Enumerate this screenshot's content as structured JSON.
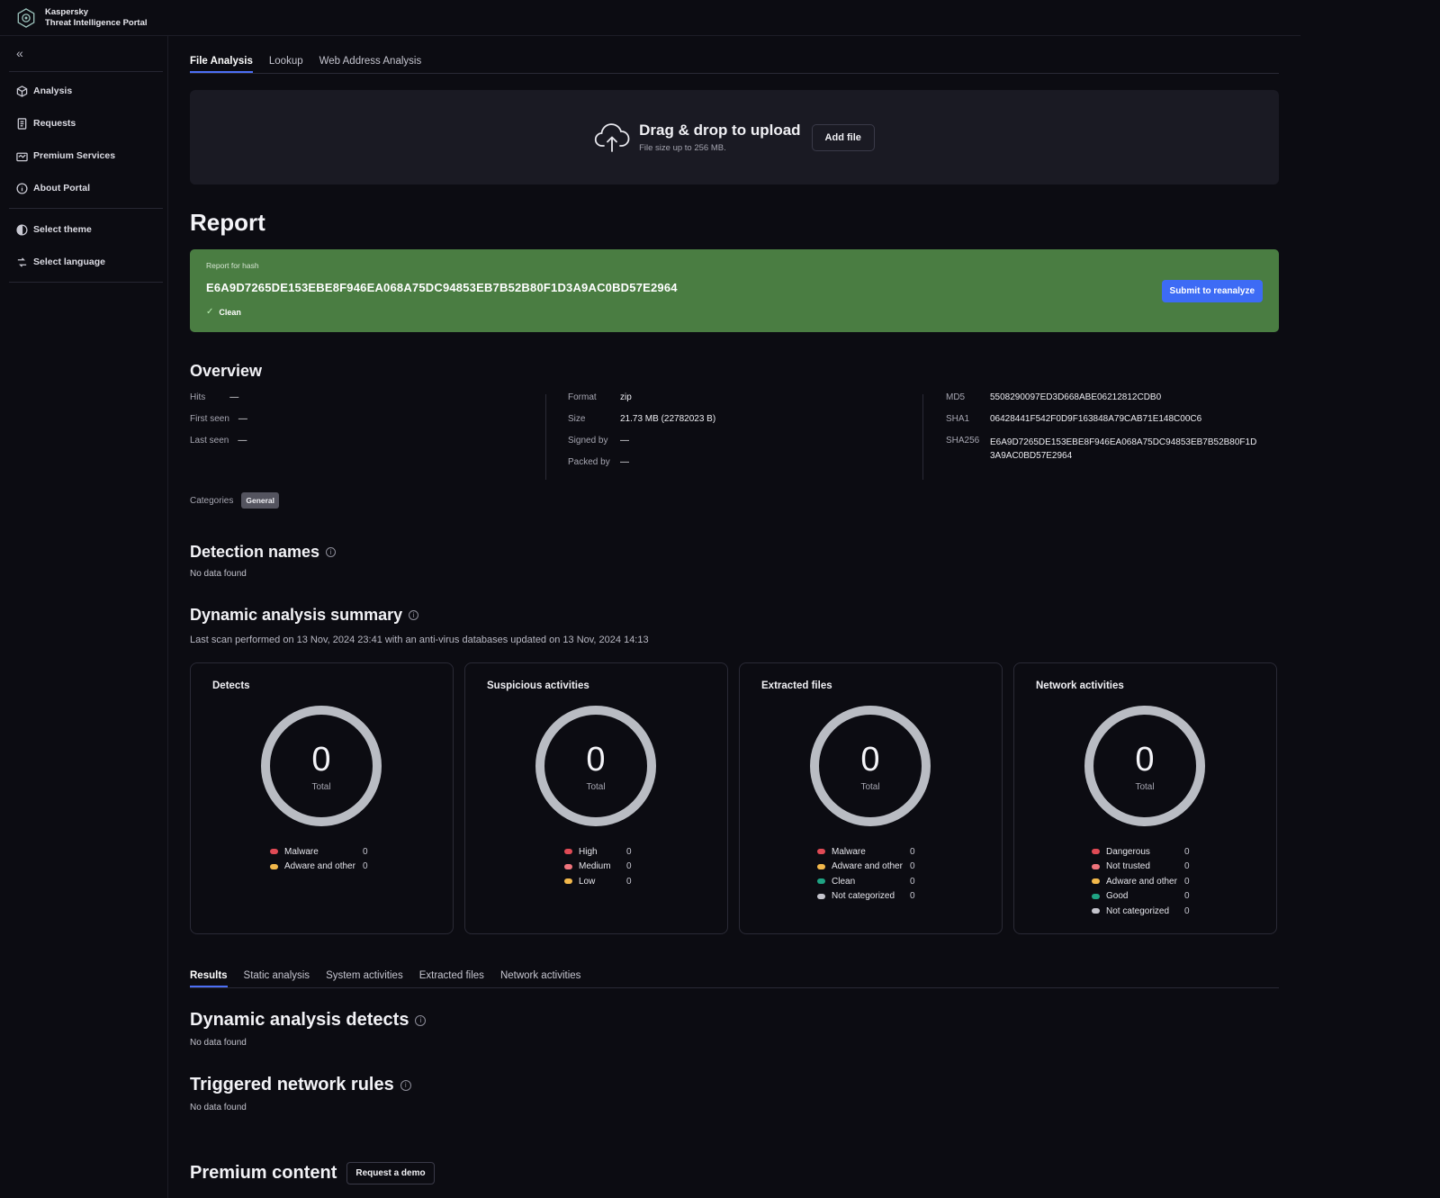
{
  "brand": {
    "line1": "Kaspersky",
    "line2": "Threat Intelligence Portal"
  },
  "sidebar": {
    "items": [
      {
        "label": "Analysis",
        "icon": "cube-icon"
      },
      {
        "label": "Requests",
        "icon": "document-icon"
      },
      {
        "label": "Premium Services",
        "icon": "premium-icon"
      },
      {
        "label": "About Portal",
        "icon": "info-icon"
      }
    ],
    "settings": [
      {
        "label": "Select theme",
        "icon": "theme-icon"
      },
      {
        "label": "Select language",
        "icon": "language-icon"
      }
    ]
  },
  "tabs": [
    "File Analysis",
    "Lookup",
    "Web Address Analysis"
  ],
  "upload": {
    "title": "Drag & drop to upload",
    "subtitle": "File size up to 256 MB.",
    "button": "Add file"
  },
  "report": {
    "heading": "Report",
    "label": "Report for hash",
    "hash": "E6A9D7265DE153EBE8F946EA068A75DC94853EB7B52B80F1D3A9AC0BD57E2964",
    "status": "Clean",
    "status_color": "#4a7d42",
    "reanalyze_button": "Submit to reanalyze"
  },
  "overview": {
    "heading": "Overview",
    "col1": [
      {
        "key": "Hits",
        "value": "—"
      },
      {
        "key": "First seen",
        "value": "—"
      },
      {
        "key": "Last seen",
        "value": "—"
      }
    ],
    "col2": [
      {
        "key": "Format",
        "value": "zip"
      },
      {
        "key": "Size",
        "value": "21.73 MB (22782023 B)"
      },
      {
        "key": "Signed by",
        "value": "—"
      },
      {
        "key": "Packed by",
        "value": "—"
      }
    ],
    "col3": [
      {
        "key": "MD5",
        "value": "5508290097ED3D668ABE06212812CDB0"
      },
      {
        "key": "SHA1",
        "value": "06428441F542F0D9F163848A79CAB71E148C00C6"
      },
      {
        "key": "SHA256",
        "value": "E6A9D7265DE153EBE8F946EA068A75DC94853EB7B52B80F1D",
        "value2": "3A9AC0BD57E2964"
      }
    ],
    "categories_label": "Categories",
    "category": "General"
  },
  "detection": {
    "heading": "Detection names",
    "empty": "No data found"
  },
  "dynamic": {
    "heading": "Dynamic analysis summary",
    "scan_text": "Last scan performed on 13 Nov, 2024 23:41 with an anti-virus databases updated on 13 Nov, 2024 14:13",
    "cards": [
      {
        "title": "Detects",
        "total": "0",
        "total_label": "Total",
        "legend": [
          {
            "label": "Malware",
            "value": "0",
            "color": "#e04a55"
          },
          {
            "label": "Adware and other",
            "value": "0",
            "color": "#f2b84b"
          }
        ]
      },
      {
        "title": "Suspicious activities",
        "total": "0",
        "total_label": "Total",
        "legend": [
          {
            "label": "High",
            "value": "0",
            "color": "#e04a55"
          },
          {
            "label": "Medium",
            "value": "0",
            "color": "#f0747c"
          },
          {
            "label": "Low",
            "value": "0",
            "color": "#f2b84b"
          }
        ]
      },
      {
        "title": "Extracted files",
        "total": "0",
        "total_label": "Total",
        "legend": [
          {
            "label": "Malware",
            "value": "0",
            "color": "#e04a55"
          },
          {
            "label": "Adware and other",
            "value": "0",
            "color": "#f2b84b"
          },
          {
            "label": "Clean",
            "value": "0",
            "color": "#1fa383"
          },
          {
            "label": "Not categorized",
            "value": "0",
            "color": "#c4c4cc"
          }
        ]
      },
      {
        "title": "Network activities",
        "total": "0",
        "total_label": "Total",
        "legend": [
          {
            "label": "Dangerous",
            "value": "0",
            "color": "#e04a55"
          },
          {
            "label": "Not trusted",
            "value": "0",
            "color": "#f0747c"
          },
          {
            "label": "Adware and other",
            "value": "0",
            "color": "#f2b84b"
          },
          {
            "label": "Good",
            "value": "0",
            "color": "#1fa383"
          },
          {
            "label": "Not categorized",
            "value": "0",
            "color": "#c4c4cc"
          }
        ]
      }
    ]
  },
  "results_tabs": [
    "Results",
    "Static analysis",
    "System activities",
    "Extracted files",
    "Network activities"
  ],
  "dyn_detects": {
    "heading": "Dynamic analysis detects",
    "empty": "No data found"
  },
  "network_rules": {
    "heading": "Triggered network rules",
    "empty": "No data found"
  },
  "premium": {
    "heading": "Premium content",
    "button": "Request a demo"
  }
}
